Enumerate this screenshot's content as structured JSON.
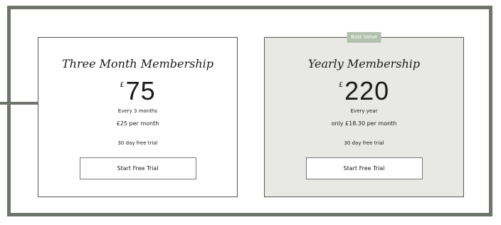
{
  "plans": [
    {
      "title": "Three Month Membership",
      "currency": "£",
      "amount": "75",
      "period": "Every 3 months",
      "monthly": "£25 per month",
      "trial_note": "30 day free trial",
      "cta_label": "Start Free Trial"
    },
    {
      "badge": "Best Value",
      "title": "Yearly Membership",
      "currency": "£",
      "amount": "220",
      "period": "Every year",
      "monthly": "only £18.30 per month",
      "trial_note": "30 day free trial",
      "cta_label": "Start Free Trial"
    }
  ],
  "colors": {
    "frame": "#6c746c",
    "highlight_card_bg": "#e8e9e4",
    "badge_bg": "#b2c1ad"
  }
}
